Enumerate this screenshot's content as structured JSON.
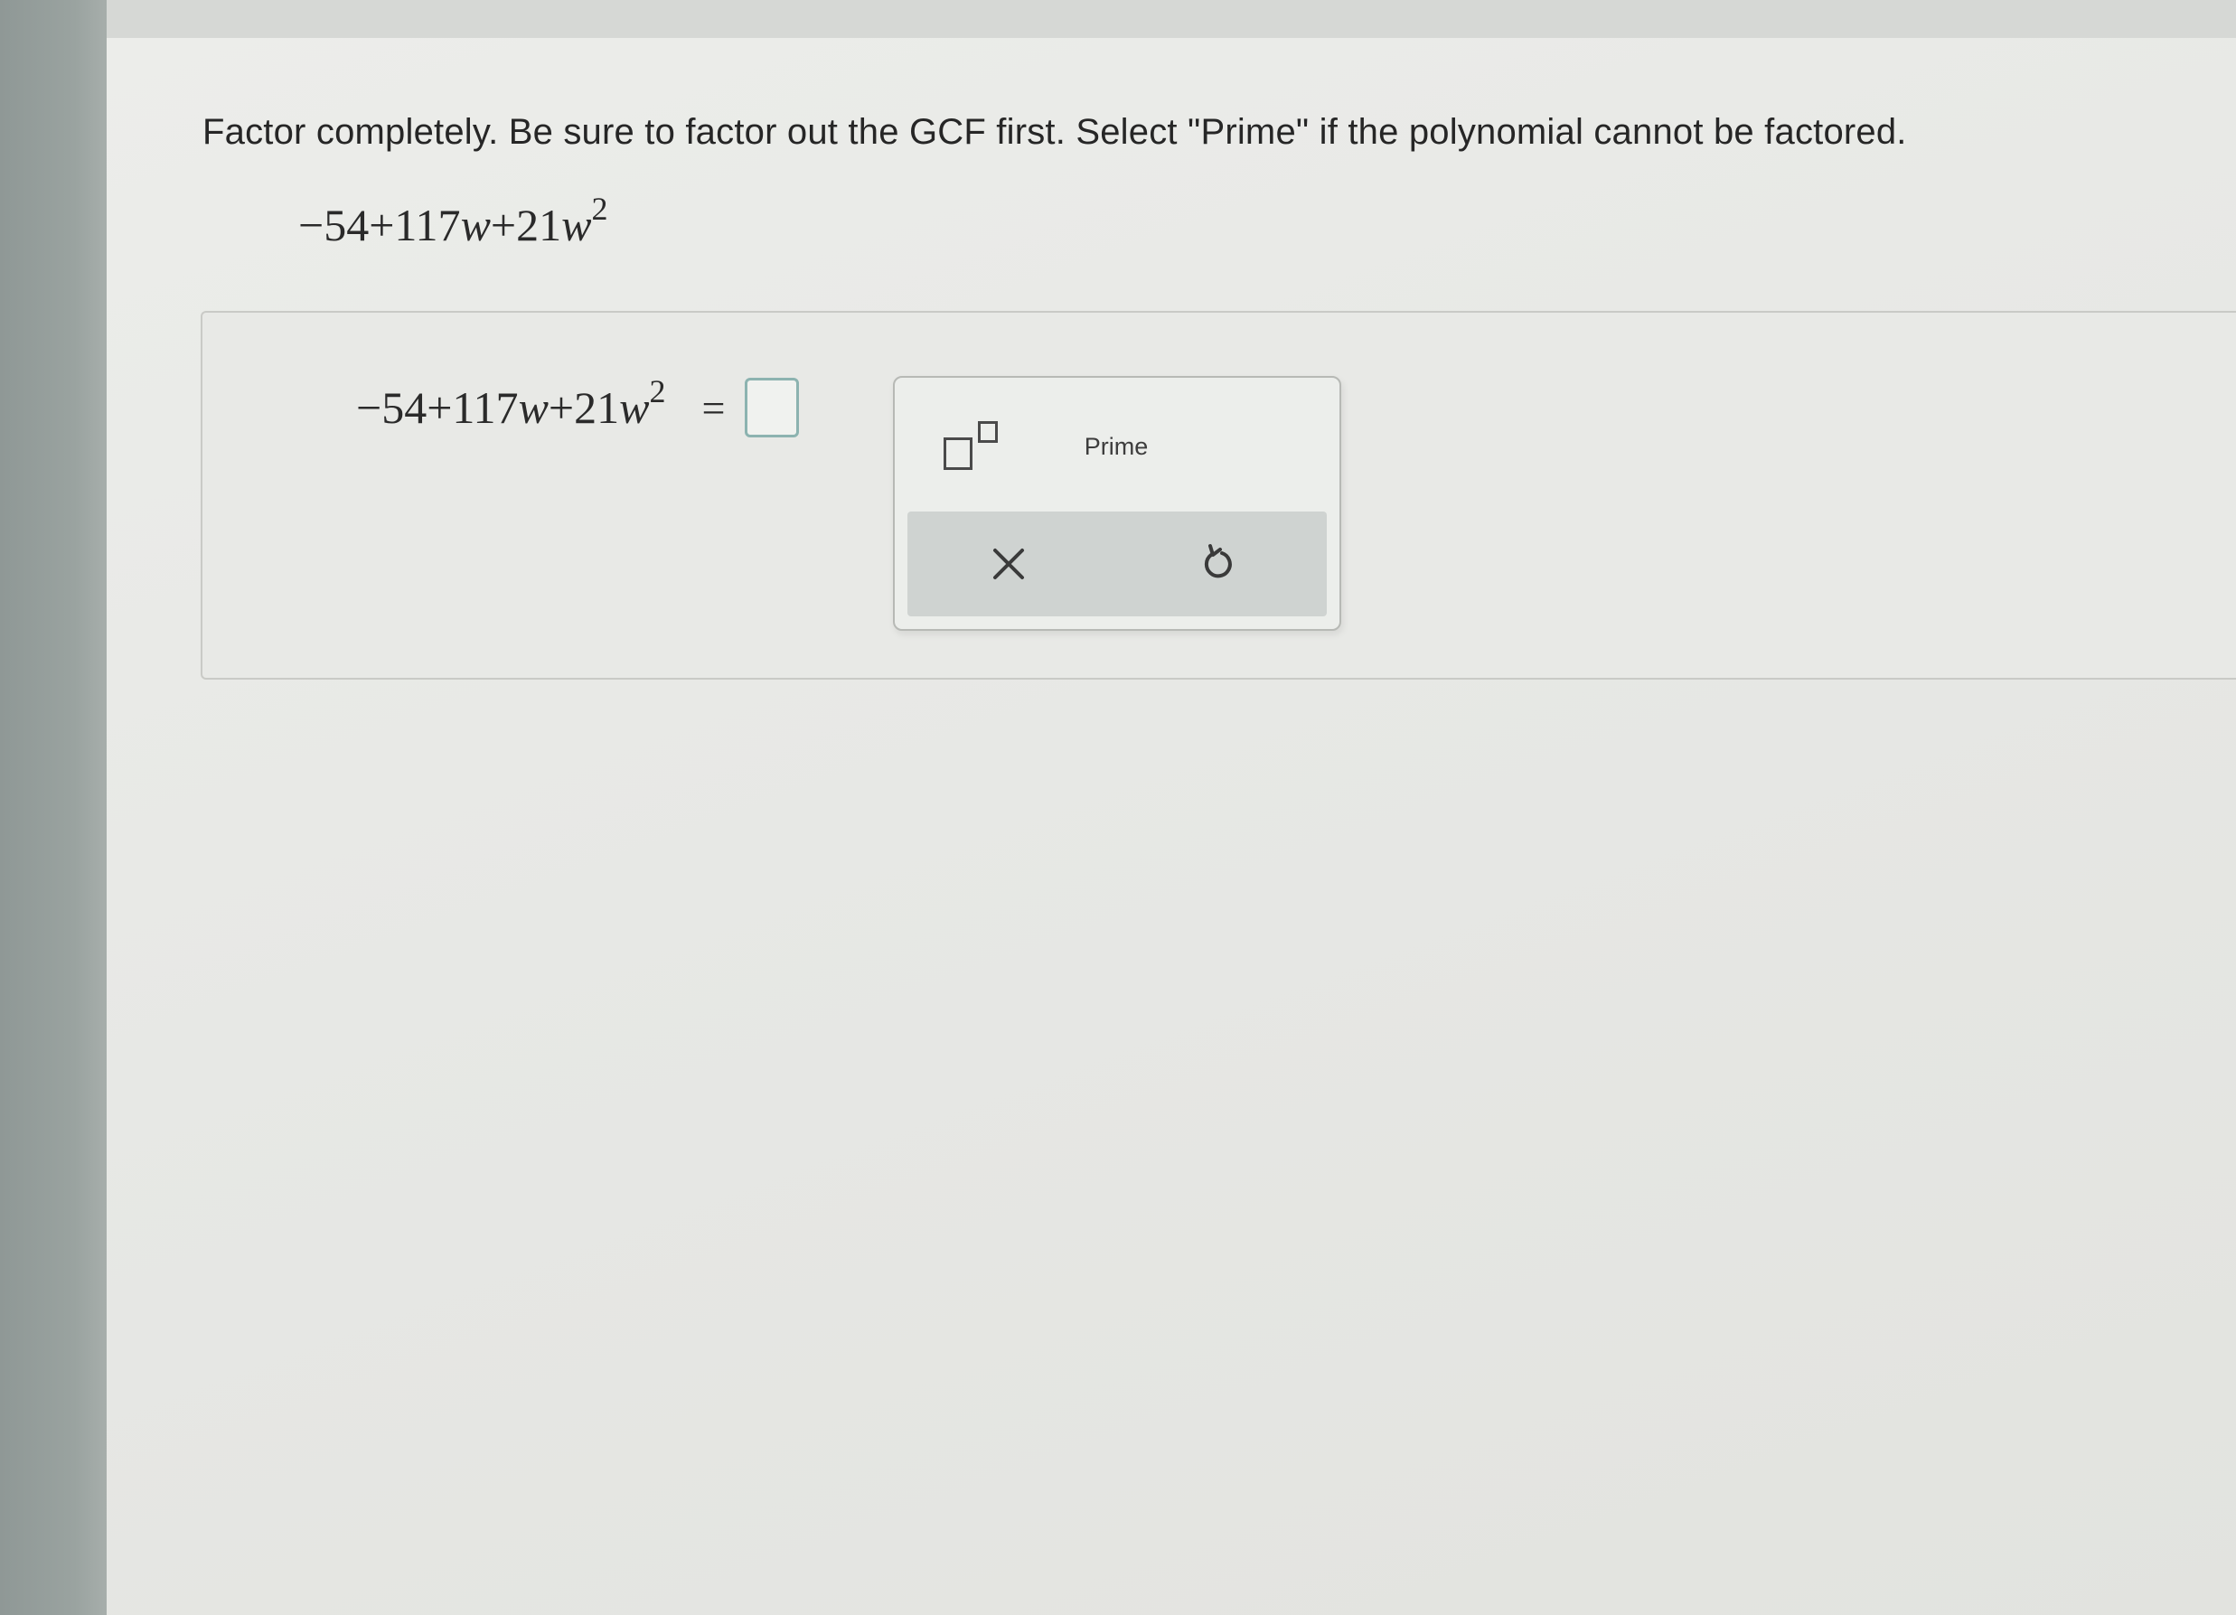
{
  "question": {
    "instructions": "Factor completely. Be sure to factor out the GCF first. Select \"Prime\" if the polynomial cannot be factored.",
    "expression": {
      "constant": "−54",
      "plus1": "+",
      "linear_coef": "117",
      "variable": "w",
      "plus2": "+",
      "quad_coef": "21",
      "exponent": "2"
    }
  },
  "answer": {
    "equals": "=",
    "input_value": ""
  },
  "palette": {
    "buttons": [
      {
        "icon": "exponent-template-icon"
      },
      {
        "label": "Prime"
      }
    ],
    "actions": [
      {
        "icon": "close-icon"
      },
      {
        "icon": "undo-icon"
      }
    ]
  },
  "colors": {
    "answer_box_border": "#8cb3b0",
    "action_bar": "#cfd3d1"
  }
}
